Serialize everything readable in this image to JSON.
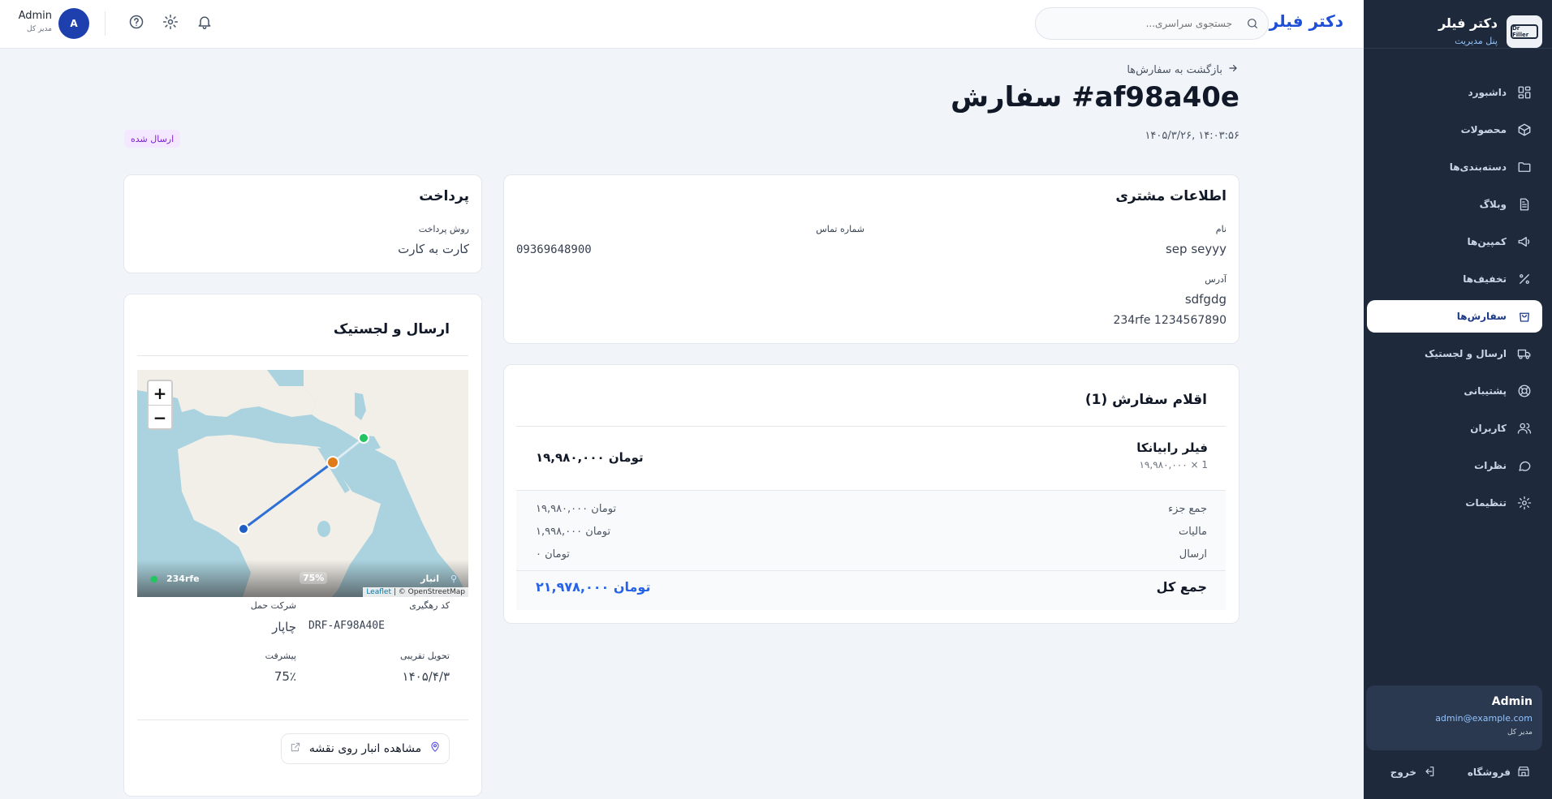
{
  "sidebar": {
    "brand_name": "دکتر فیلر",
    "brand_sub": "پنل مدیریت",
    "logo_text": "Dr Filler",
    "items": [
      {
        "label": "داشبورد",
        "icon": "dashboard-icon"
      },
      {
        "label": "محصولات",
        "icon": "box-icon"
      },
      {
        "label": "دسته‌بندی‌ها",
        "icon": "folder-icon"
      },
      {
        "label": "وبلاگ",
        "icon": "document-icon"
      },
      {
        "label": "کمپین‌ها",
        "icon": "megaphone-icon"
      },
      {
        "label": "تخفیف‌ها",
        "icon": "percent-icon"
      },
      {
        "label": "سفارش‌ها",
        "icon": "shopping-bag-icon",
        "active": true
      },
      {
        "label": "ارسال و لجستیک",
        "icon": "truck-icon"
      },
      {
        "label": "پشتیبانی",
        "icon": "lifebuoy-icon"
      },
      {
        "label": "کاربران",
        "icon": "users-icon"
      },
      {
        "label": "نظرات",
        "icon": "chat-icon"
      },
      {
        "label": "تنظیمات",
        "icon": "gear-icon"
      }
    ],
    "user": {
      "name": "Admin",
      "email": "admin@example.com",
      "role": "مدیر کل"
    },
    "store_label": "فروشگاه",
    "logout_label": "خروج"
  },
  "topbar": {
    "title": "دکتر فیلر",
    "search_placeholder": "جستجوی سراسری...",
    "user_name": "Admin",
    "user_role": "مدیر کل",
    "avatar_letter": "A"
  },
  "page": {
    "back_label": "بازگشت به سفارش‌ها",
    "title": "سفارش #af98a40e",
    "date": "۱۴۰۵/۳/۲۶, ۱۴:۰۳:۵۶",
    "status": "ارسال شده"
  },
  "customer": {
    "title": "اطلاعات مشتری",
    "name_label": "نام",
    "name": "sep seyyy",
    "phone_label": "شماره تماس",
    "phone": "09369648900",
    "address_label": "آدرس",
    "address_line1": "sdfgdg",
    "address_line2": "234rfe 1234567890"
  },
  "payment": {
    "title": "پرداخت",
    "method_label": "روش پرداخت",
    "method": "کارت به کارت"
  },
  "items": {
    "title": "اقلام سفارش (1)",
    "list": [
      {
        "name": "فیلر رابیانکا",
        "qty": "۱۹,۹۸۰,۰۰۰ × 1",
        "total": "۱۹,۹۸۰,۰۰۰ تومان"
      }
    ],
    "subtotal_label": "جمع جزء",
    "subtotal": "۱۹,۹۸۰,۰۰۰ تومان",
    "tax_label": "مالیات",
    "tax": "۱,۹۹۸,۰۰۰ تومان",
    "shipping_label": "ارسال",
    "shipping": "۰ تومان",
    "total_label": "جمع کل",
    "total": "۲۱,۹۷۸,۰۰۰ تومان"
  },
  "shipping": {
    "title": "ارسال و لجستیک",
    "map": {
      "zoom_in": "+",
      "zoom_out": "−",
      "origin_label": "انبار",
      "progress_label": "75%",
      "destination_label": "234rfe",
      "attribution_leaflet": "Leaflet",
      "attribution_osm": "| © OpenStreetMap",
      "progress": 0.75,
      "colors": {
        "route": "#2f6fd6",
        "origin": "#22c55e",
        "current": "#e07b1a",
        "destination": "#1d5fc7"
      }
    },
    "tracking_label": "کد رهگیری",
    "tracking_code": "DRF-AF98A40E",
    "carrier_label": "شرکت حمل",
    "carrier": "چاپار",
    "eta_label": "تحویل تقریبی",
    "eta": "۱۴۰۵/۴/۳",
    "progress_label": "پیشرفت",
    "progress_value": "75٪",
    "map_button": "مشاهده انبار روی نقشه"
  }
}
